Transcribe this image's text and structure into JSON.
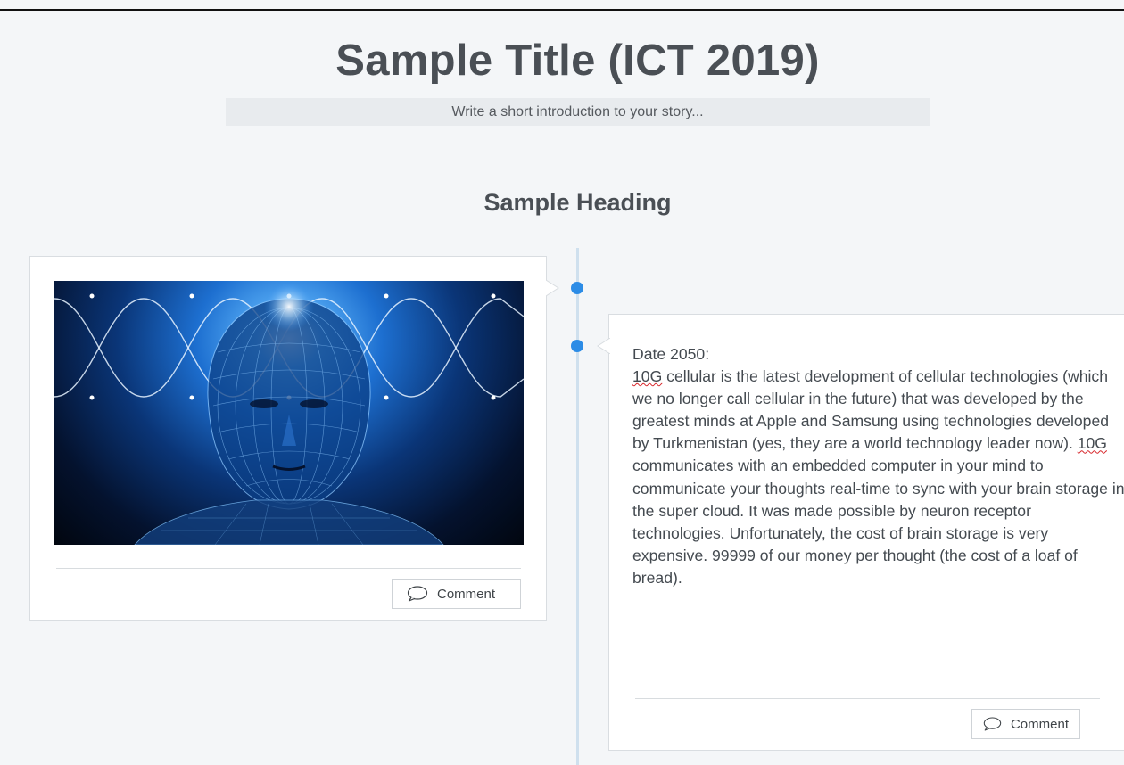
{
  "story": {
    "title": "Sample Title (ICT 2019)",
    "intro_placeholder": "Write a short introduction to your story..."
  },
  "section": {
    "heading": "Sample Heading"
  },
  "timeline": {
    "accent_color": "#2c8ce6",
    "line_color": "#cfe0ee",
    "cards": [
      {
        "kind": "image",
        "image_description": "glowing-blue-wireframe-head",
        "comment_label": "Comment"
      },
      {
        "kind": "text",
        "date_line": "Date 2050:",
        "paragraph_parts": [
          "10G",
          " cellular is the latest development of cellular technologies (which we no longer call cellular in the future) that was developed by the greatest minds at Apple and Samsung using technologies developed by Turkmenistan (yes, they are a world technology leader now). ",
          "10G",
          " communicates with an embedded computer in your mind to communicate your thoughts real-time to sync with your brain storage in the super cloud. It was made possible by neuron receptor technologies. Unfortunately, the cost of brain storage is very expensive. 99999 of our money per thought (the cost of a loaf of bread)."
        ],
        "comment_label": "Comment"
      }
    ]
  },
  "icons": {
    "comment": "speech-bubble-icon"
  }
}
